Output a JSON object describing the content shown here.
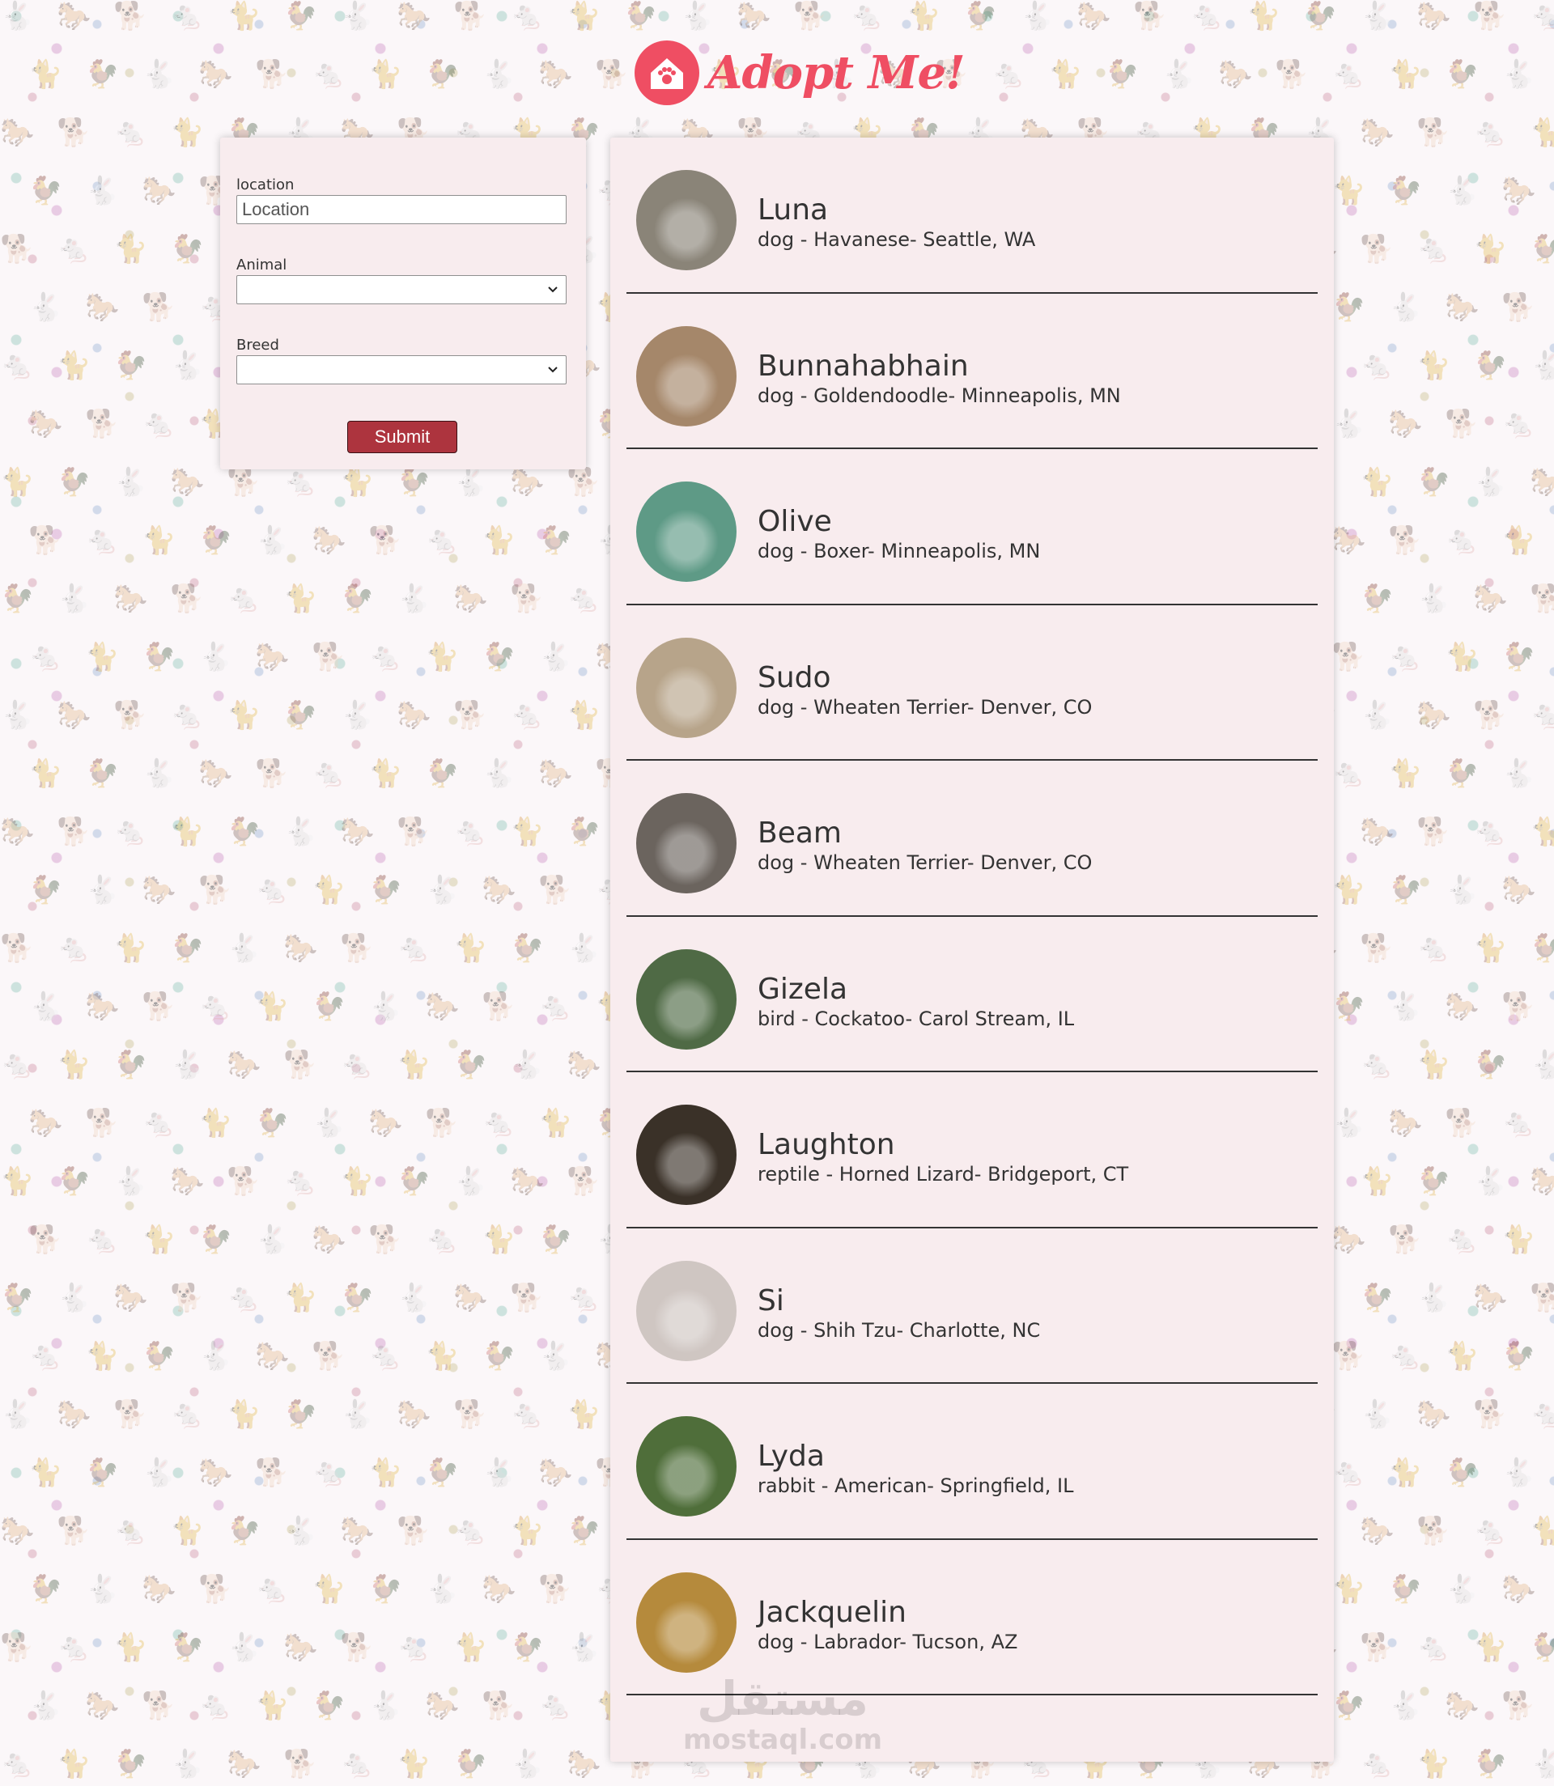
{
  "header": {
    "logo_text": "Adopt Me!",
    "brand_color": "#ef4e63"
  },
  "search": {
    "location_label": "location",
    "location_placeholder": "Location",
    "location_value": "",
    "animal_label": "Animal",
    "animal_selected": "",
    "breed_label": "Breed",
    "breed_selected": "",
    "submit_label": "Submit",
    "submit_color": "#ad343e"
  },
  "pets": [
    {
      "name": "Luna",
      "desc": "dog - Havanese- Seattle, WA",
      "photo_icon": "havanese-photo",
      "tone": "#8a8478"
    },
    {
      "name": "Bunnahabhain",
      "desc": "dog - Goldendoodle- Minneapolis, MN",
      "photo_icon": "goldendoodle-photo",
      "tone": "#a5876a"
    },
    {
      "name": "Olive",
      "desc": "dog - Boxer- Minneapolis, MN",
      "photo_icon": "boxer-photo",
      "tone": "#5e9a86"
    },
    {
      "name": "Sudo",
      "desc": "dog - Wheaten Terrier- Denver, CO",
      "photo_icon": "terrier-photo",
      "tone": "#b7a48a"
    },
    {
      "name": "Beam",
      "desc": "dog - Wheaten Terrier- Denver, CO",
      "photo_icon": "terrier-photo",
      "tone": "#6b645e"
    },
    {
      "name": "Gizela",
      "desc": "bird - Cockatoo- Carol Stream, IL",
      "photo_icon": "cockatoo-photo",
      "tone": "#4f6a45"
    },
    {
      "name": "Laughton",
      "desc": "reptile - Horned Lizard- Bridgeport, CT",
      "photo_icon": "lizard-photo",
      "tone": "#3a3128"
    },
    {
      "name": "Si",
      "desc": "dog - Shih Tzu- Charlotte, NC",
      "photo_icon": "shih-tzu-photo",
      "tone": "#cfc6c2"
    },
    {
      "name": "Lyda",
      "desc": "rabbit - American- Springfield, IL",
      "photo_icon": "rabbit-photo",
      "tone": "#4f6e3a"
    },
    {
      "name": "Jackquelin",
      "desc": "dog - Labrador- Tucson, AZ",
      "photo_icon": "labrador-photo",
      "tone": "#b58a3c"
    }
  ],
  "watermark": {
    "arabic": "مستقل",
    "latin": "mostaql.com"
  }
}
